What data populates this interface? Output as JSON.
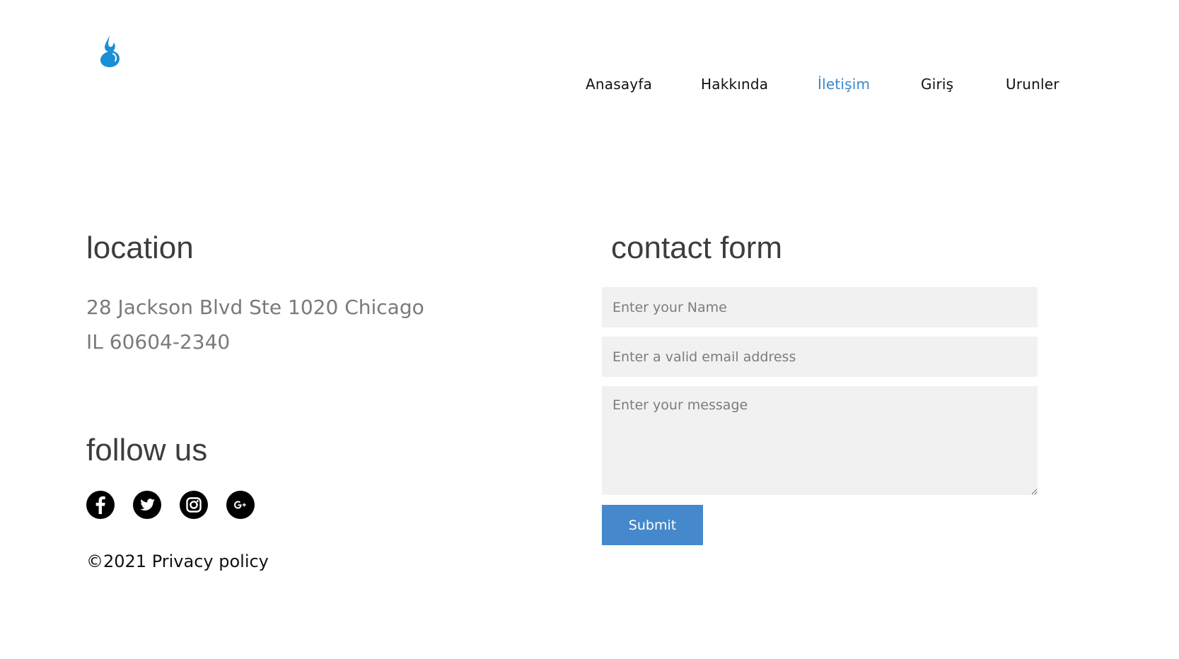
{
  "header": {
    "logo_icon": "water-drop-icon",
    "accent_color": "#1a8fd6",
    "nav": [
      {
        "label": "Anasayfa",
        "active": false
      },
      {
        "label": "Hakkında",
        "active": false
      },
      {
        "label": "İletişim",
        "active": true
      },
      {
        "label": "Giriş",
        "active": false
      },
      {
        "label": "Urunler",
        "active": false
      }
    ],
    "nav_active_color": "#3a87cc"
  },
  "location": {
    "title": "location",
    "address_line1": "28 Jackson Blvd Ste 1020 Chicago",
    "address_line2": "IL 60604-2340"
  },
  "follow": {
    "title": "follow us",
    "icons": [
      "facebook-icon",
      "twitter-icon",
      "instagram-icon",
      "google-plus-icon"
    ]
  },
  "footer": {
    "text": "©2021 Privacy policy"
  },
  "contact": {
    "title": "contact form",
    "name_placeholder": "Enter your Name",
    "email_placeholder": "Enter a valid email address",
    "message_placeholder": "Enter your message",
    "submit_label": "Submit",
    "submit_color": "#4588cb"
  }
}
